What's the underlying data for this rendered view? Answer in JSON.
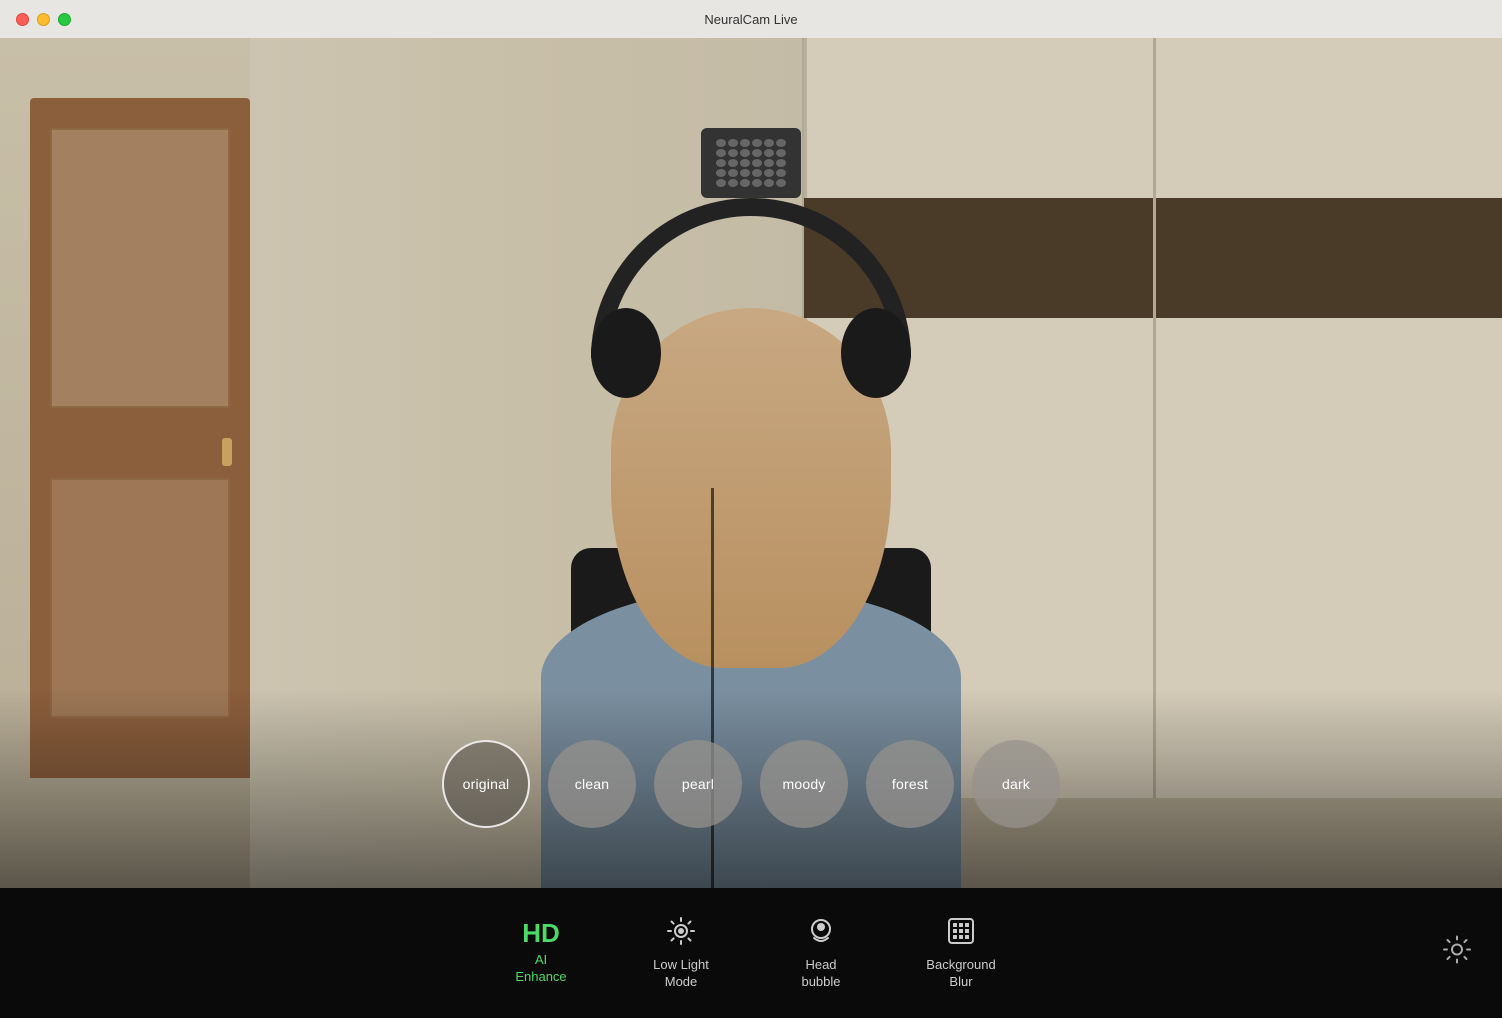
{
  "app": {
    "title": "NeuralCam Live"
  },
  "titlebar": {
    "close_label": "",
    "min_label": "",
    "max_label": ""
  },
  "filters": [
    {
      "id": "original",
      "label": "original",
      "selected": true
    },
    {
      "id": "clean",
      "label": "clean",
      "selected": false
    },
    {
      "id": "pearl",
      "label": "pearl",
      "selected": false
    },
    {
      "id": "moody",
      "label": "moody",
      "selected": false
    },
    {
      "id": "forest",
      "label": "forest",
      "selected": false
    },
    {
      "id": "dark",
      "label": "dark",
      "selected": false
    }
  ],
  "toolbar": {
    "hd_label": "HD",
    "ai_enhance_label": "AI\nEnhance",
    "low_light_label": "Low Light\nMode",
    "head_bubble_label": "Head\nbubble",
    "background_blur_label": "Background\nBlur",
    "settings_label": "Settings"
  },
  "colors": {
    "active_green": "#4cd964",
    "toolbar_bg": "#0a0a0a",
    "toolbar_text": "#cccccc"
  }
}
